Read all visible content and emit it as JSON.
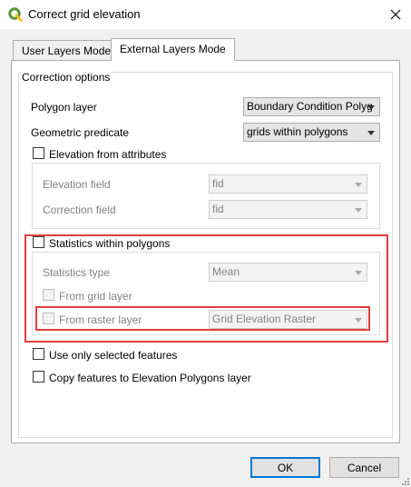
{
  "window": {
    "title": "Correct grid elevation"
  },
  "tabs": [
    {
      "label": "User Layers Mode",
      "active": false
    },
    {
      "label": "External Layers Mode",
      "active": true
    }
  ],
  "correction_options": {
    "title": "Correction options",
    "polygon_layer": {
      "label": "Polygon layer",
      "value": "Boundary Condition Polyg"
    },
    "geometric_predicate": {
      "label": "Geometric predicate",
      "value": "grids within polygons"
    },
    "elevation_from_attributes": {
      "label": "Elevation from attributes",
      "checked": false,
      "elevation_field": {
        "label": "Elevation field",
        "value": "fid"
      },
      "correction_field": {
        "label": "Correction field",
        "value": "fid"
      }
    },
    "statistics_within_polygons": {
      "label": "Statistics within polygons",
      "checked": false,
      "statistics_type": {
        "label": "Statistics type",
        "value": "Mean"
      },
      "from_grid_layer": {
        "label": "From grid layer",
        "checked": false
      },
      "from_raster_layer": {
        "label": "From raster layer",
        "checked": false,
        "value": "Grid Elevation Raster"
      }
    },
    "use_only_selected": {
      "label": "Use only selected features",
      "checked": false
    },
    "copy_features": {
      "label": "Copy features to Elevation Polygons layer",
      "checked": false
    }
  },
  "buttons": {
    "ok": "OK",
    "cancel": "Cancel"
  },
  "colors": {
    "highlight": "#e43d3d",
    "qgis_green": "#589632",
    "qgis_yellow": "#ee7913"
  }
}
